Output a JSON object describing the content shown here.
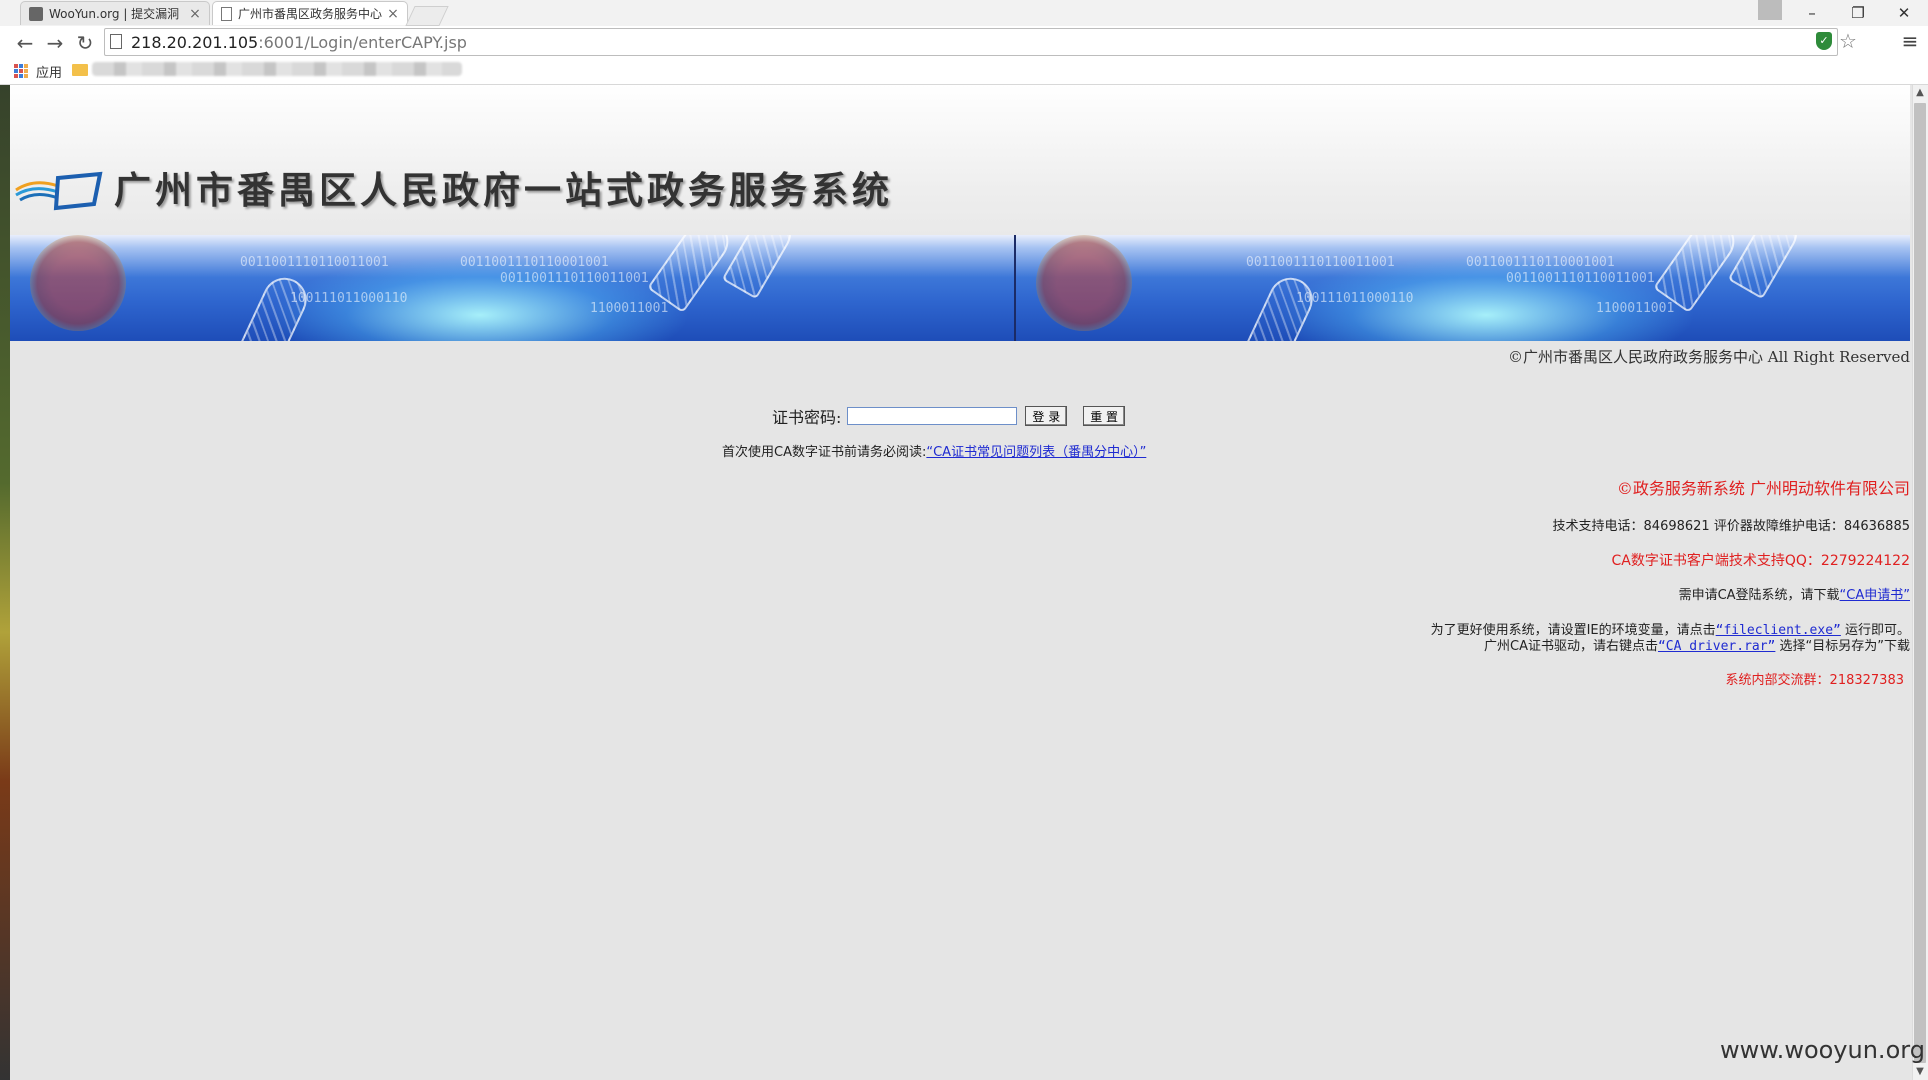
{
  "browser": {
    "tabs": [
      {
        "title": "WooYun.org | 提交漏洞"
      },
      {
        "title": "广州市番禺区政务服务中心"
      }
    ],
    "address": {
      "host": "218.20.201.105",
      "path": ":6001/Login/enterCAPY.jsp"
    },
    "bookmarks": {
      "apps_label": "应用"
    }
  },
  "header": {
    "system_title": "广州市番禺区人民政府一站式政务服务系统"
  },
  "banner": {
    "bits_1": "0011001110110011001",
    "bits_2": "0011001110110011001",
    "bits_3": "100111011000110",
    "bits_4": "0011001110110001001",
    "bits_5": "1100011001"
  },
  "copyright": "©广州市番禺区人民政府政务服务中心 All Right Reserved",
  "login": {
    "password_label": "证书密码:",
    "password_value": "",
    "login_button": "登 录",
    "reset_button": "重 置"
  },
  "faq": {
    "prefix": "首次使用CA数字证书前请务必阅读:",
    "link": "“CA证书常见问题列表（番禺分中心）”"
  },
  "info": {
    "vendor": "©政务服务新系统 广州明动软件有限公司",
    "support_phone": "技术支持电话：84698621 评价器故障维护电话：84636885",
    "ca_support_qq": "CA数字证书客户端技术支持QQ：2279224122",
    "apply_prefix": "需申请CA登陆系统，请下载",
    "apply_link": "“CA申请书”",
    "env_prefix": "为了更好使用系统，请设置IE的环境变量，请点击",
    "env_link": "“fileclient.exe”",
    "env_suffix": " 运行即可。",
    "driver_prefix": "广州CA证书驱动，请右键点击",
    "driver_link": "“CA driver.rar”",
    "driver_suffix": " 选择“目标另存为”下载",
    "group": "系统内部交流群：218327383"
  },
  "watermark": "www.wooyun.org"
}
